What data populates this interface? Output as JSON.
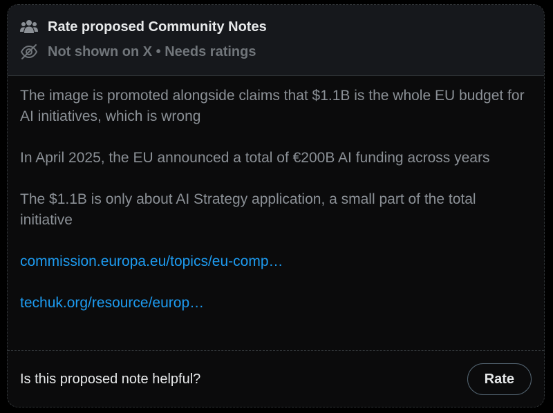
{
  "header": {
    "title": "Rate proposed Community Notes",
    "title_icon": "people-group-icon",
    "status": "Not shown on X • Needs ratings",
    "status_icon": "eye-off-icon"
  },
  "note": {
    "paragraphs": [
      "The image is promoted alongside claims that $1.1B is the whole EU budget for AI initiatives, which is wrong",
      "In April 2025, the EU announced a total of €200B AI funding across years",
      "The $1.1B is only about AI Strategy application, a small part of the total initiative"
    ],
    "links": [
      "commission.europa.eu/topics/eu-comp…",
      "techuk.org/resource/europ…"
    ]
  },
  "footer": {
    "question": "Is this proposed note helpful?",
    "rate_label": "Rate"
  },
  "colors": {
    "background": "#000000",
    "card": "#0b0b0c",
    "header": "#16181c",
    "text_primary": "#e7e9ea",
    "text_secondary": "#71767b",
    "link": "#1d9bf0",
    "border": "#2f3336"
  }
}
